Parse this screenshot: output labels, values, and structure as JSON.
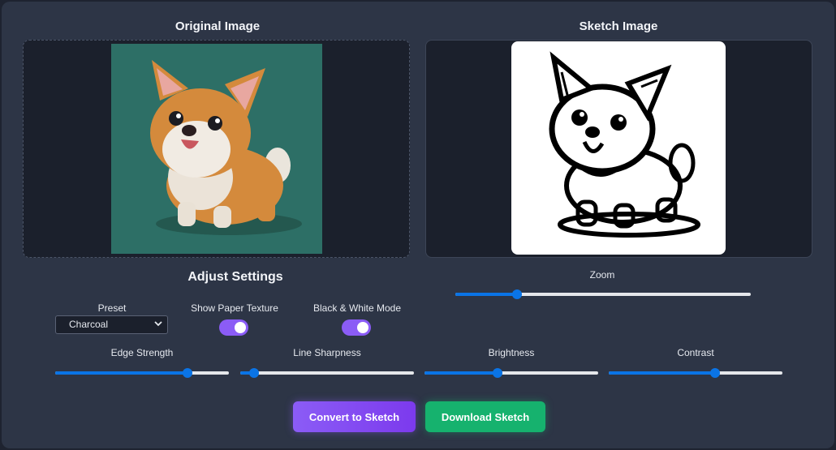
{
  "original": {
    "title": "Original Image",
    "bg_color": "#2d6f66"
  },
  "sketch": {
    "title": "Sketch Image"
  },
  "settings": {
    "title": "Adjust Settings",
    "preset": {
      "label": "Preset",
      "value": "Charcoal"
    },
    "paper_texture": {
      "label": "Show Paper Texture",
      "on": true
    },
    "bw_mode": {
      "label": "Black & White Mode",
      "on": true
    },
    "zoom": {
      "label": "Zoom",
      "value": 0.21
    },
    "edge_strength": {
      "label": "Edge Strength",
      "value": 0.76
    },
    "line_sharpness": {
      "label": "Line Sharpness",
      "value": 0.08
    },
    "brightness": {
      "label": "Brightness",
      "value": 0.42
    },
    "contrast": {
      "label": "Contrast",
      "value": 0.61
    }
  },
  "actions": {
    "convert_label": "Convert to Sketch",
    "download_label": "Download Sketch"
  },
  "colors": {
    "accent": "#8b5cf6",
    "download": "#16b26e",
    "slider": "#0a74e6",
    "panel": "#2d3546"
  }
}
